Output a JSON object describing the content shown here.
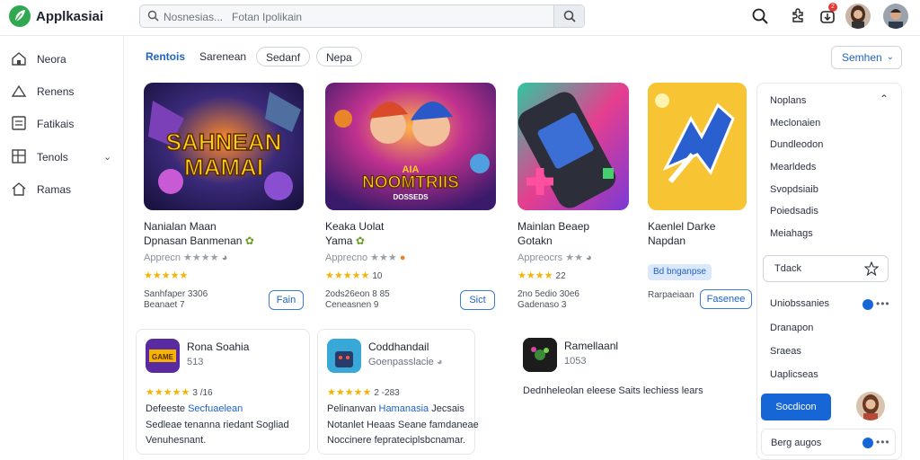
{
  "app": {
    "title": "Applkasiai"
  },
  "search": {
    "placeholder": "Nosnesias...   Fotan Ipolikain"
  },
  "colors": {
    "accent": "#1f62c7",
    "brand": "#2fa84f",
    "star": "#f4b400",
    "primary_button": "#1766d6"
  },
  "header": {
    "icons": [
      "search-icon",
      "puzzle-icon",
      "download-icon",
      "user-avatar",
      "account-avatar"
    ],
    "notification_count": "2"
  },
  "sidebar": {
    "items": [
      {
        "label": "Neora",
        "icon": "home-icon"
      },
      {
        "label": "Renens",
        "icon": "triangle-icon"
      },
      {
        "label": "Fatikais",
        "icon": "list-icon"
      },
      {
        "label": "Tenols",
        "icon": "grid-icon",
        "has_chevron": true
      },
      {
        "label": "Ramas",
        "icon": "house-icon"
      }
    ]
  },
  "tabs": [
    {
      "label": "Rentois"
    },
    {
      "label": "Sarenean"
    },
    {
      "label": "Sedanf"
    },
    {
      "label": "Nepa"
    }
  ],
  "sort_button": {
    "label": "Semhen"
  },
  "featured": [
    {
      "image_text": [
        "SAHNEAN",
        "MAMAI"
      ],
      "title_1": "Nanialan Maan",
      "title_2": "Dpnasan Banmenan",
      "subtitle": "Apprecn",
      "rating": 3.5,
      "meta_1": "Sanhfaper  3306",
      "meta_2": "Beanaet  7",
      "button": "Fain"
    },
    {
      "image_text": [
        "AIA",
        "NOOMTRIIS",
        "DOSSEDS"
      ],
      "title_1": "Keaka Uolat",
      "title_2": "Yama",
      "subtitle": "Apprecno",
      "rating": 5,
      "rating_text": "10",
      "meta_1": "2ods26eon  8 85",
      "meta_2": "Ceneasnen  9",
      "button": "Sict"
    },
    {
      "title_1": "Mainlan Beaep",
      "title_2": "Gotakn",
      "subtitle": "Appreocrs",
      "rating": 4,
      "rating_text": "22",
      "meta_1": "2no 5edio  30e6",
      "meta_2": "Gadenaso  3"
    },
    {
      "title_1": "Kaenlel Darke",
      "title_2": "Napdan",
      "tag": "Bd bnganpse",
      "meta_1": "Rarpaeiaan",
      "button": "Fasenee"
    }
  ],
  "small_cards": [
    {
      "title": "Rona Soahia",
      "subtitle": "513",
      "rating_text": "3 /16",
      "line_1_prefix": "Defeeste ",
      "line_1_link": "Secfuaelean",
      "line_2": "Sedleae tenanna riedant Sogliad",
      "line_3": "Venuhesnant."
    },
    {
      "title": "Coddhandail",
      "subtitle": "Goenpasslacie",
      "rating_text": "2 -283",
      "line_1_prefix": "Pelinanvan ",
      "line_1_link": "Hamanasia",
      "line_1_suffix": " Jecsais",
      "line_2": "Notanlet Heaas Seane famdaneae",
      "line_3": "Noccinere feprateciplsbcnamar."
    },
    {
      "title": "Ramellaanl",
      "subtitle": "1053",
      "line_1": "Dednheleolan eleese Saits lechiess lears"
    }
  ],
  "right_panel": {
    "header": "Noplans",
    "items": [
      "Meclonaien",
      "Dundleodon",
      "Mearldeds",
      "Svopdsiaib",
      "Poiedsadis",
      "Meiahags"
    ],
    "search_label": "Tdack",
    "section_items": [
      "Uniobssanies",
      "Dranapon",
      "Sraeas",
      "Uaplicseas"
    ],
    "button": "Socdicon",
    "footer": "Berg augos"
  }
}
